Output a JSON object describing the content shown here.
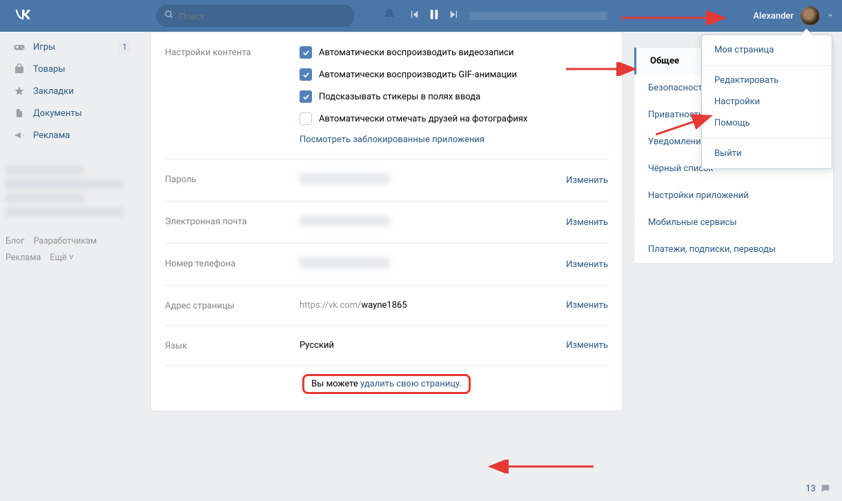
{
  "header": {
    "search_placeholder": "Поиск",
    "user_name": "Alexander"
  },
  "left_nav": {
    "items": [
      {
        "label": "Игры",
        "badge": "1"
      },
      {
        "label": "Товары"
      },
      {
        "label": "Закладки"
      },
      {
        "label": "Документы"
      },
      {
        "label": "Реклама"
      }
    ],
    "footer": [
      "Блог",
      "Разработчикам",
      "Реклама",
      "Ещё ˅"
    ]
  },
  "content_settings": {
    "section_label": "Настройки контента",
    "auto_video": "Автоматически воспроизводить видеозаписи",
    "auto_gif": "Автоматически воспроизводить GIF-анимации",
    "stickers_hint": "Подсказывать стикеры в полях ввода",
    "auto_tag": "Автоматически отмечать друзей на фотографиях",
    "blocked_apps": "Посмотреть заблокированные приложения"
  },
  "fields": {
    "password_label": "Пароль",
    "email_label": "Электронная почта",
    "phone_label": "Номер телефона",
    "address_label": "Адрес страницы",
    "address_prefix": "https://vk.com/",
    "address_value": "wayne1865",
    "language_label": "Язык",
    "language_value": "Русский",
    "change": "Изменить"
  },
  "delete": {
    "prefix": "Вы можете ",
    "link": "удалить свою страницу."
  },
  "right_nav": {
    "items": [
      "Общее",
      "Безопасность",
      "Приватность",
      "Уведомления",
      "Чёрный список",
      "Настройки приложений",
      "Мобильные сервисы",
      "Платежи, подписки, переводы"
    ]
  },
  "dropdown": {
    "items": [
      "Моя страница",
      "Редактировать",
      "Настройки",
      "Помощь"
    ],
    "exit": "Выйти"
  },
  "chat_badge": "13"
}
